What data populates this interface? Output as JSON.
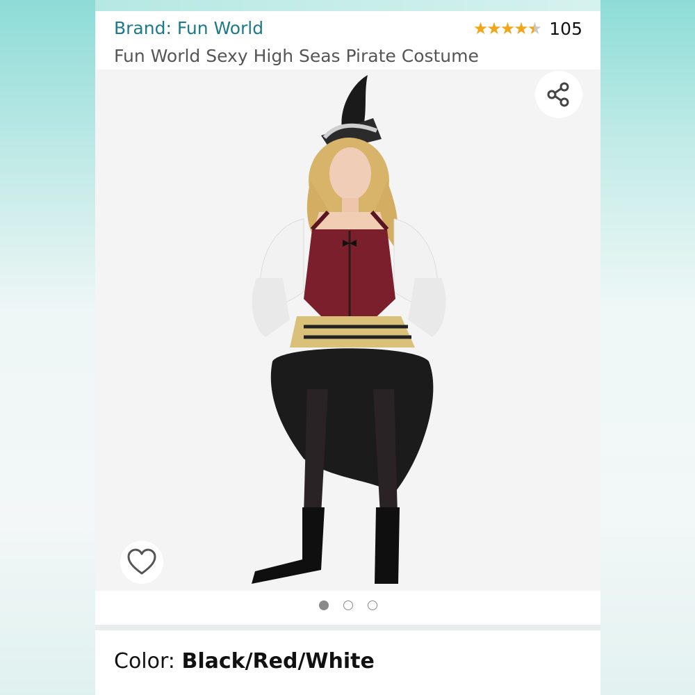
{
  "product": {
    "brand": "Brand: Fun World",
    "title": "Fun World Sexy High Seas Pirate Costume",
    "rating_stars": "★★★★",
    "rating_half": "★",
    "rating_value": 4.5,
    "review_count": "105",
    "color_label": "Color: ",
    "color_value": "Black/Red/White"
  },
  "gallery": {
    "image_count": 3,
    "active_index": 0,
    "share_icon": "share-icon",
    "wishlist_icon": "heart-icon"
  },
  "colors": {
    "brand_link": "#1b7b8a",
    "star": "#f1a619",
    "dot_active": "#8a8a8a",
    "bodice": "#7a1f2b"
  }
}
